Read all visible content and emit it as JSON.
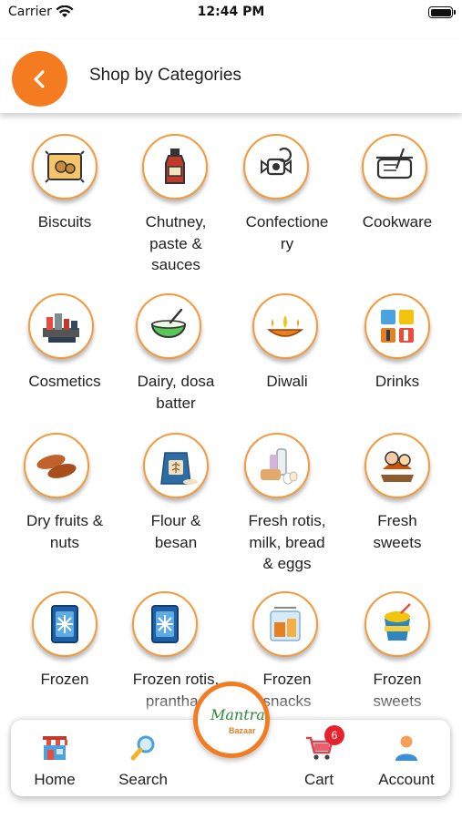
{
  "status_bar": {
    "carrier": "Carrier",
    "time": "12:44 PM"
  },
  "header": {
    "title": "Shop by Categories"
  },
  "categories": [
    {
      "label": "Biscuits",
      "icon": "biscuit-packet-icon"
    },
    {
      "label": "Chutney, paste & sauces",
      "icon": "sauce-bottle-icon"
    },
    {
      "label": "Confectionery",
      "icon": "candy-icon"
    },
    {
      "label": "Cookware",
      "icon": "cookware-icon"
    },
    {
      "label": "Cosmetics",
      "icon": "cosmetics-icon"
    },
    {
      "label": "Dairy, dosa batter",
      "icon": "batter-bowl-icon"
    },
    {
      "label": "Diwali",
      "icon": "diya-lamp-icon"
    },
    {
      "label": "Drinks",
      "icon": "drinks-icon"
    },
    {
      "label": "Dry fruits & nuts",
      "icon": "dates-icon"
    },
    {
      "label": "Flour & besan",
      "icon": "flour-sack-icon"
    },
    {
      "label": "Fresh rotis, milk, bread & eggs",
      "icon": "milk-bread-eggs-icon"
    },
    {
      "label": "Fresh sweets",
      "icon": "sweets-icon"
    },
    {
      "label": "Frozen",
      "icon": "freezer-icon"
    },
    {
      "label": "Frozen rotis, pranthas",
      "icon": "freezer-icon"
    },
    {
      "label": "Frozen snacks",
      "icon": "frozen-snacks-icon"
    },
    {
      "label": "Frozen sweets",
      "icon": "frozen-dessert-icon"
    }
  ],
  "bottom_nav": {
    "home": "Home",
    "search": "Search",
    "cart": "Cart",
    "cart_count": "6",
    "account": "Account"
  },
  "logo": {
    "script": "Mantra",
    "sub": "Bazaar"
  },
  "colors": {
    "accent": "#f47b20",
    "ring": "#f39a3c",
    "badge": "#e5232c"
  }
}
